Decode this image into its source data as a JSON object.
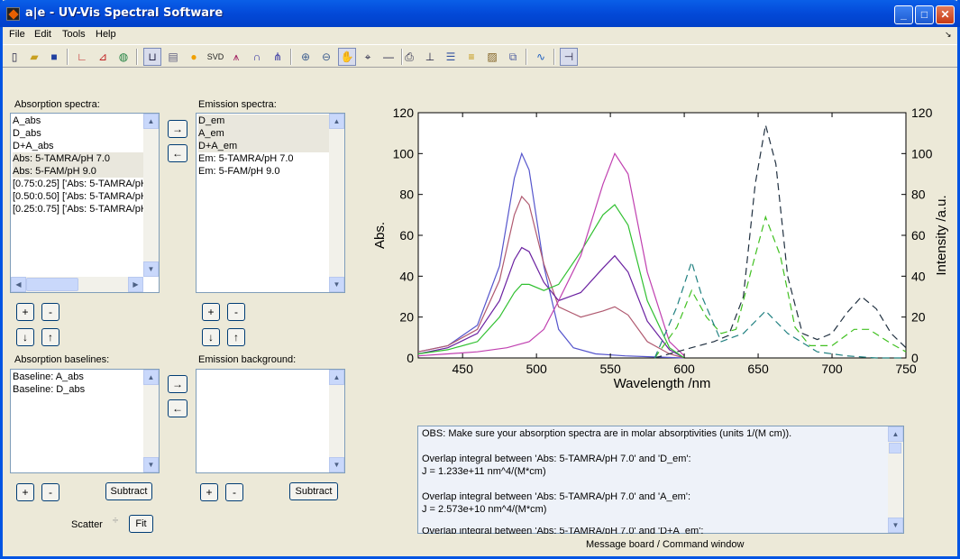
{
  "window": {
    "title": "a|e - UV-Vis Spectral Software"
  },
  "menus": [
    "File",
    "Edit",
    "Tools",
    "Help"
  ],
  "toolbar": {
    "svd_label": "SVD"
  },
  "absorption_spectra": {
    "label": "Absorption spectra:",
    "items": [
      "A_abs",
      "D_abs",
      "D+A_abs",
      "Abs: 5-TAMRA/pH 7.0",
      "Abs: 5-FAM/pH 9.0",
      "[0.75:0.25] ['Abs: 5-TAMRA/pH",
      "[0.50:0.50] ['Abs: 5-TAMRA/pH",
      "[0.25:0.75] ['Abs: 5-TAMRA/pH"
    ]
  },
  "emission_spectra": {
    "label": "Emission spectra:",
    "items": [
      "D_em",
      "A_em",
      "D+A_em",
      "Em: 5-TAMRA/pH 7.0",
      "Em: 5-FAM/pH 9.0"
    ]
  },
  "absorption_baselines": {
    "label": "Absorption baselines:",
    "items": [
      "Baseline: A_abs",
      "Baseline: D_abs"
    ]
  },
  "emission_background": {
    "label": "Emission background:",
    "items": []
  },
  "buttons": {
    "add": "+",
    "remove": "-",
    "down": "↓",
    "up": "↑",
    "move_right": "→",
    "move_left": "←",
    "subtract": "Subtract",
    "fit": "Fit"
  },
  "scatter": {
    "label": "Scatter"
  },
  "message_board": {
    "caption": "Message board / Command window",
    "lines": [
      "OBS: Make sure your absorption spectra are in molar absorptivities (units 1/(M cm)).",
      "",
      "Overlap integral between 'Abs: 5-TAMRA/pH 7.0' and 'D_em':",
      "J = 1.233e+11 nm^4/(M*cm)",
      "",
      "Overlap integral between 'Abs: 5-TAMRA/pH 7.0' and 'A_em':",
      "J = 2.573e+10 nm^4/(M*cm)",
      "",
      "Overlap integral between 'Abs: 5-TAMRA/pH 7.0' and 'D+A_em':"
    ]
  },
  "chart_data": {
    "type": "line",
    "xlabel": "Wavelength /nm",
    "ylabel": "Abs.",
    "y2label": "Intensity /a.u.",
    "xlim": [
      420,
      750
    ],
    "ylim": [
      0,
      120
    ],
    "y2lim": [
      0,
      120
    ],
    "xticks": [
      450,
      500,
      550,
      600,
      650,
      700,
      750
    ],
    "yticks": [
      0,
      20,
      40,
      60,
      80,
      100,
      120
    ],
    "series": [
      {
        "color": "#5555cc",
        "dash": false,
        "x": [
          420,
          440,
          460,
          475,
          485,
          490,
          495,
          505,
          515,
          525,
          540,
          560,
          580,
          600
        ],
        "y": [
          3,
          6,
          16,
          45,
          88,
          100,
          92,
          45,
          14,
          5,
          2,
          1,
          0.5,
          0
        ]
      },
      {
        "color": "#b05a70",
        "dash": false,
        "x": [
          420,
          440,
          460,
          475,
          485,
          490,
          495,
          505,
          515,
          530,
          545,
          553,
          562,
          575,
          590,
          600
        ],
        "y": [
          3,
          6,
          14,
          38,
          70,
          79,
          75,
          46,
          25,
          20,
          23,
          25,
          21,
          8,
          2,
          0
        ]
      },
      {
        "color": "#6a20a0",
        "dash": false,
        "x": [
          420,
          440,
          460,
          475,
          485,
          490,
          495,
          505,
          515,
          530,
          545,
          553,
          562,
          575,
          590,
          600
        ],
        "y": [
          2,
          5,
          12,
          28,
          48,
          54,
          52,
          37,
          28,
          32,
          44,
          50,
          42,
          18,
          4,
          0
        ]
      },
      {
        "color": "#30c030",
        "dash": false,
        "x": [
          420,
          440,
          460,
          475,
          485,
          490,
          495,
          505,
          515,
          530,
          545,
          553,
          562,
          575,
          590,
          600
        ],
        "y": [
          2,
          4,
          8,
          20,
          32,
          36,
          36,
          33,
          36,
          52,
          70,
          75,
          65,
          28,
          5,
          0
        ]
      },
      {
        "color": "#c040b0",
        "dash": false,
        "x": [
          420,
          440,
          460,
          480,
          495,
          505,
          515,
          530,
          545,
          553,
          562,
          575,
          590,
          600
        ],
        "y": [
          1,
          2,
          3,
          5,
          8,
          14,
          28,
          50,
          85,
          100,
          90,
          42,
          8,
          1
        ]
      },
      {
        "color": "#203040",
        "dash": true,
        "x": [
          580,
          600,
          620,
          630,
          640,
          648,
          655,
          662,
          670,
          680,
          690,
          700,
          710,
          720,
          730,
          740,
          750
        ],
        "y": [
          0,
          4,
          8,
          11,
          30,
          85,
          114,
          95,
          40,
          12,
          9,
          12,
          22,
          30,
          24,
          12,
          5
        ]
      },
      {
        "color": "#40c020",
        "dash": true,
        "x": [
          580,
          595,
          605,
          615,
          625,
          635,
          645,
          655,
          665,
          675,
          685,
          700,
          715,
          725,
          740,
          750
        ],
        "y": [
          0,
          15,
          33,
          20,
          12,
          14,
          42,
          69,
          50,
          15,
          6,
          6,
          14,
          14,
          7,
          3
        ]
      },
      {
        "color": "#208080",
        "dash": true,
        "x": [
          580,
          595,
          605,
          612,
          625,
          640,
          655,
          670,
          690,
          710,
          730,
          750
        ],
        "y": [
          0,
          25,
          47,
          30,
          8,
          12,
          23,
          12,
          3,
          1,
          0,
          0
        ]
      }
    ]
  }
}
